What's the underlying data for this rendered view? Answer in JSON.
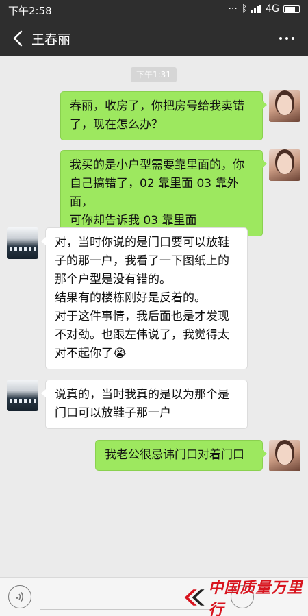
{
  "status_bar": {
    "time": "下午2:58",
    "network": "4G"
  },
  "header": {
    "contact_name": "王春丽"
  },
  "chat": {
    "timestamp": "下午1:31",
    "messages": [
      {
        "sender": "self",
        "text": "春丽，收房了，你把房号给我卖错\n了，现在怎么办？"
      },
      {
        "sender": "self",
        "text": "我买的是小户型需要靠里面的，你\n自己搞错了，02 靠里面 03 靠外面，\n可你却告诉我 03 靠里面"
      },
      {
        "sender": "other",
        "text": "对，当时你说的是门口要可以放鞋\n子的那一户，我看了一下图纸上的\n那个户型是没有错的。\n结果有的楼栋刚好是反着的。\n对于这件事情，我后面也是才发现\n不对劲。也跟左伟说了，我觉得太\n对不起你了😭"
      },
      {
        "sender": "other",
        "text": "说真的，当时我真的是以为那个是\n门口可以放鞋子那一户"
      },
      {
        "sender": "self",
        "text": "我老公很忌讳门口对着门口"
      }
    ]
  },
  "watermark": {
    "text": "中国质量万里行"
  },
  "colors": {
    "bar_background": "#2e2e2e",
    "chat_background": "#ebebeb",
    "self_bubble": "#9de85f",
    "other_bubble": "#ffffff",
    "watermark_red": "#d8141e"
  }
}
